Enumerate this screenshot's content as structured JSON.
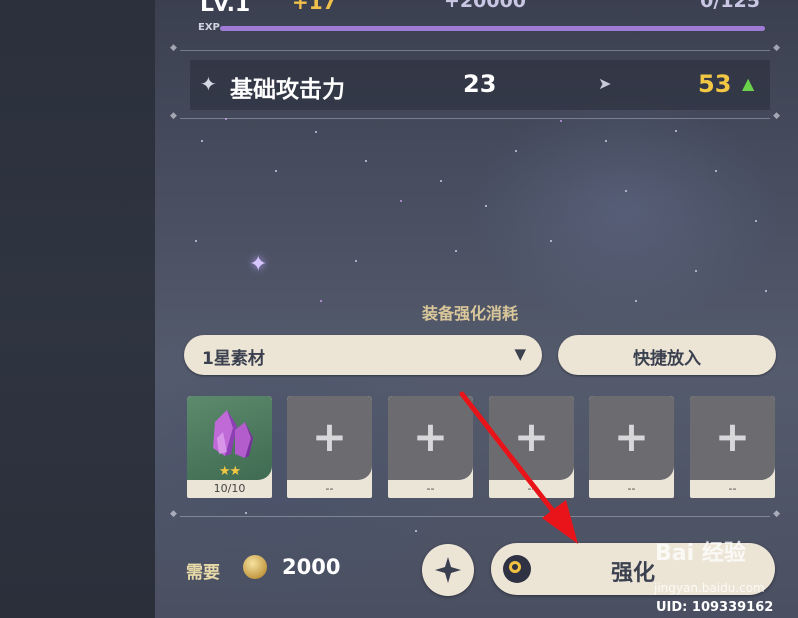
{
  "header": {
    "level": "Lv.1",
    "level_gain": "+17",
    "exp_gain": "+20000",
    "exp_count": "0/125",
    "exp_label": "EXP",
    "exp_fill_fraction": 1.0
  },
  "stat": {
    "name": "基础攻击力",
    "current": "23",
    "next": "53",
    "icon": "sparkle-icon",
    "arrow_icon": "arrow-right-icon",
    "up_icon": "arrow-up-icon"
  },
  "cost": {
    "title": "装备强化消耗",
    "filter": "1星素材",
    "quick_place": "快捷放入"
  },
  "slots": [
    {
      "filled": true,
      "caption": "10/10",
      "stars": "★★"
    },
    {
      "filled": false,
      "caption": "--"
    },
    {
      "filled": false,
      "caption": "--"
    },
    {
      "filled": false,
      "caption": "--"
    },
    {
      "filled": false,
      "caption": "--"
    },
    {
      "filled": false,
      "caption": "--"
    }
  ],
  "footer": {
    "need_label": "需要",
    "amount": "2000",
    "enhance_label": "强化",
    "uid": "UID: 109339162"
  },
  "watermark": {
    "text": "Bai 经验",
    "sub": "jingyan.baidu.com"
  },
  "colors": {
    "accent_gold": "#f2c744",
    "up_green": "#6bd14a",
    "button_bg": "#ece5d6",
    "annotation_red": "#e8141a"
  }
}
